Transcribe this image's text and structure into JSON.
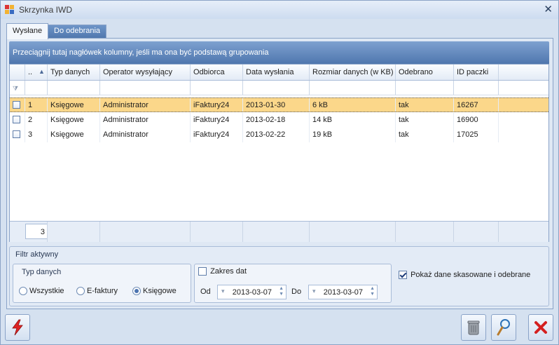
{
  "window": {
    "title": "Skrzynka IWD"
  },
  "tabs": [
    {
      "label": "Wysłane"
    },
    {
      "label": "Do odebrania"
    }
  ],
  "group_hint": "Przeciągnij tutaj nagłówek kolumny, jeśli ma ona być podstawą grupowania",
  "columns": {
    "lp": "..",
    "typ": "Typ danych",
    "operator": "Operator wysyłający",
    "odbiorca": "Odbiorca",
    "data": "Data wysłania",
    "rozmiar": "Rozmiar danych (w KB)",
    "odebrano": "Odebrano",
    "id": "ID paczki"
  },
  "rows": [
    {
      "lp": "1",
      "typ": "Księgowe",
      "operator": "Administrator",
      "odbiorca": "iFaktury24",
      "data": "2013-01-30",
      "rozmiar": "6 kB",
      "odebrano": "tak",
      "id": "16267",
      "selected": true
    },
    {
      "lp": "2",
      "typ": "Księgowe",
      "operator": "Administrator",
      "odbiorca": "iFaktury24",
      "data": "2013-02-18",
      "rozmiar": "14 kB",
      "odebrano": "tak",
      "id": "16900"
    },
    {
      "lp": "3",
      "typ": "Księgowe",
      "operator": "Administrator",
      "odbiorca": "iFaktury24",
      "data": "2013-02-22",
      "rozmiar": "19 kB",
      "odebrano": "tak",
      "id": "17025"
    }
  ],
  "footer_count": "3",
  "filter": {
    "title": "Filtr aktywny",
    "typ_danych": {
      "title": "Typ danych",
      "options": [
        "Wszystkie",
        "E-faktury",
        "Księgowe"
      ],
      "selected": "Księgowe"
    },
    "zakres": {
      "label": "Zakres dat",
      "checked": false,
      "od_label": "Od",
      "od_value": "2013-03-07",
      "do_label": "Do",
      "do_value": "2013-03-07"
    },
    "pokaz": {
      "label": "Pokaż dane skasowane i odebrane",
      "checked": true
    }
  },
  "icons": {
    "lightning": "lightning-icon",
    "trash": "trash-icon",
    "magnifier": "magnifier-icon",
    "cancel": "cancel-x-icon"
  },
  "colors": {
    "selected_row": "#fbd78a",
    "group_panel": "#5f86bd",
    "accent_red": "#d42020"
  }
}
